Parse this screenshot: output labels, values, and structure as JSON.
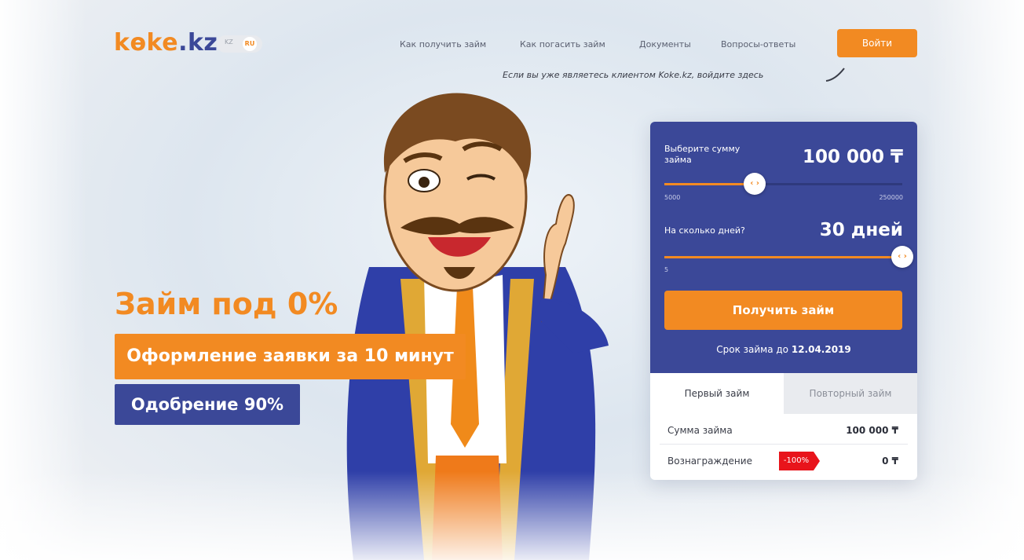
{
  "header": {
    "logo_main": "kөke",
    "logo_tld": ".kz",
    "lang": {
      "kz": "KZ",
      "ru": "RU"
    },
    "nav": [
      "Как получить займ",
      "Как погасить займ",
      "Документы",
      "Вопросы-ответы"
    ],
    "login_label": "Войти",
    "hint": "Если вы уже являетесь клиентом Koke.kz, войдите здесь"
  },
  "promo": {
    "title": "Займ под 0%",
    "badge_orange": "Оформление заявки за 10 минут",
    "badge_blue": "Одобрение 90%"
  },
  "calculator": {
    "amount_label_line1": "Выберите сумму",
    "amount_label_line2": "займа",
    "amount_value": "100 000 ₸",
    "amount_min": "5000",
    "amount_max": "250000",
    "amount_fraction": 0.38,
    "days_label": "На сколько дней?",
    "days_value": "30 дней",
    "days_min": "5",
    "days_fraction": 1.0,
    "submit_label": "Получить займ",
    "term_prefix": "Срок займа до ",
    "term_date": "12.04.2019",
    "tabs": {
      "first": "Первый займ",
      "repeat": "Повторный займ"
    },
    "rows": {
      "sum_label": "Сумма займа",
      "sum_value": "100 000 ₸",
      "reward_label": "Вознаграждение",
      "reward_badge": "-100%",
      "reward_value": "0 ₸"
    }
  },
  "colors": {
    "brand_orange": "#f28a22",
    "brand_blue": "#3b4898",
    "discount_red": "#e8141b"
  },
  "icons": [
    "slider-handle-icon",
    "curved-arrow-icon",
    "mascot-illustration"
  ]
}
